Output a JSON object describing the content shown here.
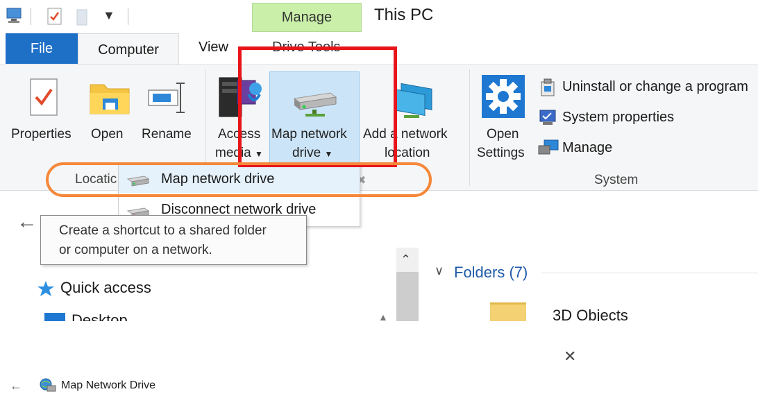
{
  "window": {
    "title": "This PC",
    "context_tab_header": "Manage"
  },
  "tabs": {
    "file": "File",
    "computer": "Computer",
    "view": "View",
    "drive_tools": "Drive Tools"
  },
  "ribbon": {
    "location_group": {
      "label": "Locatic",
      "buttons": {
        "properties": "Properties",
        "open": "Open",
        "rename": "Rename"
      }
    },
    "network_group": {
      "access_media_line1": "Access",
      "access_media_line2": "media",
      "map_drive_line1": "Map network",
      "map_drive_line2": "drive",
      "add_location_line1": "Add a network",
      "add_location_line2": "location"
    },
    "system_group": {
      "label": "System",
      "open_settings_line1": "Open",
      "open_settings_line2": "Settings",
      "uninstall": "Uninstall or change a program",
      "system_properties": "System properties",
      "manage": "Manage"
    }
  },
  "dropdown": {
    "items": [
      "Map network drive",
      "Disconnect network drive"
    ]
  },
  "tooltip": {
    "line1": "Create a shortcut to a shared folder",
    "line2": "or computer on a network."
  },
  "nav_pane": {
    "quick_access": "Quick access",
    "desktop": "Desktop"
  },
  "content": {
    "folders_header": "Folders (7)",
    "first_folder": "3D Objects"
  },
  "dialog": {
    "title": "Map Network Drive"
  },
  "colors": {
    "file_tab": "#1e6fc6",
    "context_tab": "#c9efa9",
    "highlight": "#cce4f7",
    "annotation_red": "#e8141a",
    "annotation_orange": "#f5883a"
  }
}
